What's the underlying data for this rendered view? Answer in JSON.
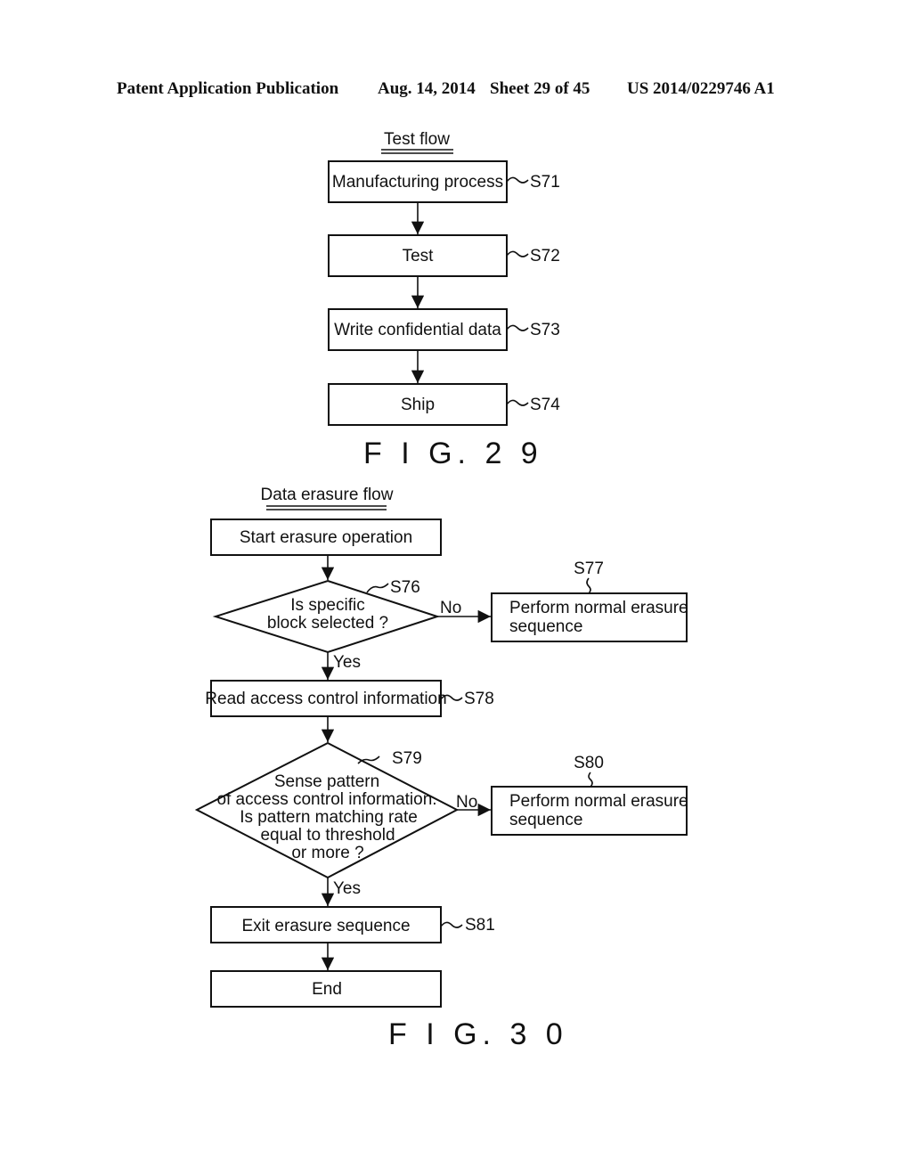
{
  "header": {
    "publication": "Patent Application Publication",
    "date": "Aug. 14, 2014",
    "sheet": "Sheet 29 of 45",
    "number": "US 2014/0229746 A1"
  },
  "fig29": {
    "title": "Test flow",
    "caption": "F I G. 2 9",
    "steps": [
      {
        "text": "Manufacturing process",
        "ref": "S71"
      },
      {
        "text": "Test",
        "ref": "S72"
      },
      {
        "text": "Write confidential data",
        "ref": "S73"
      },
      {
        "text": "Ship",
        "ref": "S74"
      }
    ]
  },
  "fig30": {
    "title": "Data erasure flow",
    "caption": "F I G. 3 0",
    "start": "Start erasure operation",
    "d1": {
      "lines": [
        "Is specific",
        "block selected ?"
      ],
      "ref": "S76",
      "no": "No",
      "yes": "Yes"
    },
    "s77": {
      "lines": [
        "Perform normal erasure",
        "sequence"
      ],
      "ref": "S77"
    },
    "s78": {
      "text": "Read access control information",
      "ref": "S78"
    },
    "d2": {
      "lines": [
        "Sense pattern",
        "of access control information.",
        "Is pattern matching rate",
        "equal to threshold",
        "or more ?"
      ],
      "ref": "S79",
      "no": "No",
      "yes": "Yes"
    },
    "s80": {
      "lines": [
        "Perform normal erasure",
        "sequence"
      ],
      "ref": "S80"
    },
    "s81": {
      "text": "Exit erasure sequence",
      "ref": "S81"
    },
    "end": "End"
  }
}
